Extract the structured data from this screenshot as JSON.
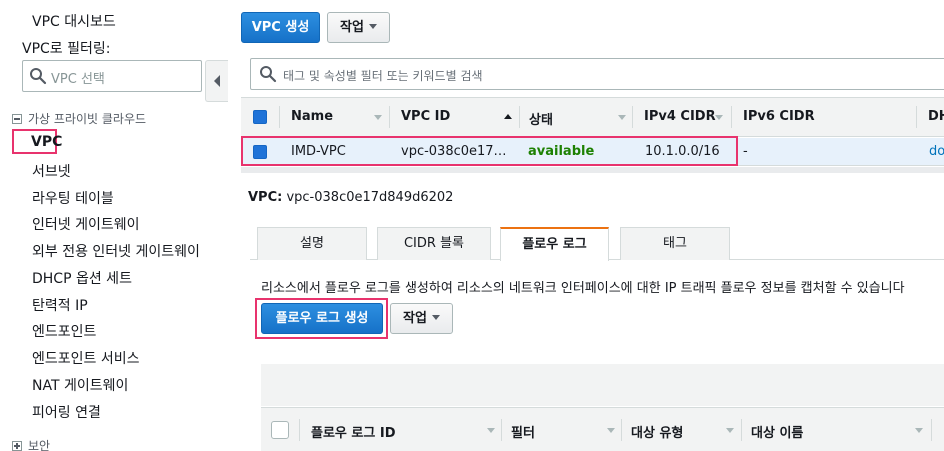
{
  "sidebar": {
    "top_item": "VPC 대시보드",
    "filter_label": "VPC로 필터링:",
    "filter_placeholder": "VPC 선택",
    "section_title": "가상 프라이빗 클라우드",
    "active_item": "VPC",
    "items": [
      "서브넷",
      "라우팅 테이블",
      "인터넷 게이트웨이",
      "외부 전용 인터넷 게이트웨이",
      "DHCP 옵션 세트",
      "탄력적 IP",
      "엔드포인트",
      "엔드포인트 서비스",
      "NAT 게이트웨이",
      "피어링 연결"
    ],
    "next_section": "보안"
  },
  "toolbar": {
    "create_vpc": "VPC 생성",
    "actions": "작업"
  },
  "filter": {
    "placeholder": "태그 및 속성별 필터 또는 키워드별 검색"
  },
  "table": {
    "columns": [
      "Name",
      "VPC ID",
      "상태",
      "IPv4 CIDR",
      "IPv6 CIDR",
      "DH"
    ],
    "rows": [
      {
        "name": "IMD-VPC",
        "vpc_id": "vpc-038c0e17…",
        "status": "available",
        "ipv4": "10.1.0.0/16",
        "ipv6": "-",
        "dhcp": "do"
      }
    ]
  },
  "detail": {
    "label": "VPC:",
    "vpc_id": "vpc-038c0e17d849d6202",
    "tabs": [
      "설명",
      "CIDR 블록",
      "플로우 로그",
      "태그"
    ],
    "active_tab": 2,
    "description": "리소스에서 플로우 로그를 생성하여 리소스의 네트워크 인터페이스에 대한 IP 트래픽 플로우 정보를 캡처할 수 있습니다",
    "create_flow_log": "플로우 로그 생성",
    "actions": "작업",
    "columns": [
      "플로우 로그 ID",
      "필터",
      "대상 유형",
      "대상 이름"
    ]
  },
  "colors": {
    "primary": "#1671c8",
    "highlight": "#e8336d",
    "available": "#1d8102",
    "active_tab": "#ec7211"
  }
}
